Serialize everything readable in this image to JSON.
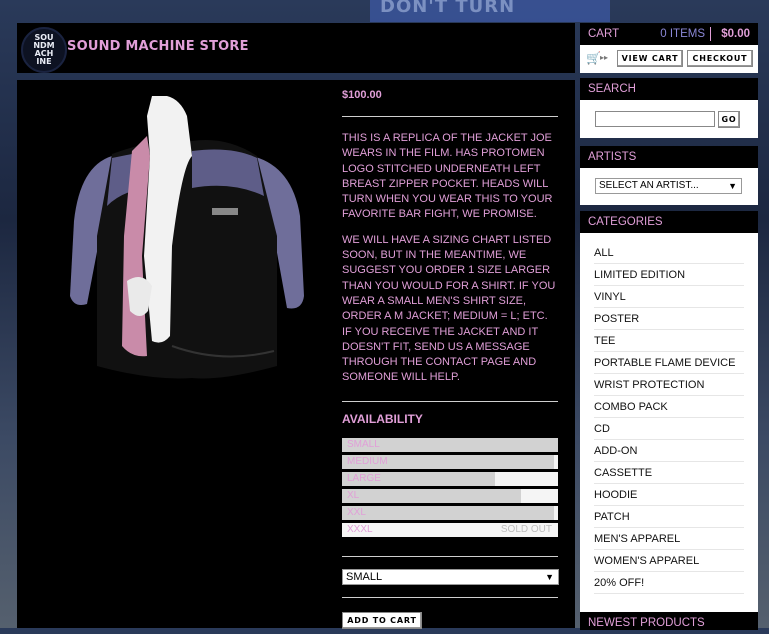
{
  "store": {
    "logo_text": "SOUND MACHINE",
    "name": "SOUND MACHINE STORE"
  },
  "product": {
    "price": "$100.00",
    "description": [
      "THIS IS A REPLICA OF THE JACKET JOE WEARS IN THE FILM. HAS PROTOMEN LOGO STITCHED UNDERNEATH LEFT BREAST ZIPPER POCKET. HEADS WILL TURN WHEN YOU WEAR THIS TO YOUR FAVORITE BAR FIGHT, WE PROMISE.",
      "WE WILL HAVE A SIZING CHART LISTED SOON, BUT IN THE MEANTIME, WE SUGGEST YOU ORDER 1 SIZE LARGER THAN YOU WOULD FOR A SHIRT. IF YOU WEAR A SMALL MEN'S SHIRT SIZE, ORDER A M JACKET; MEDIUM = L; ETC. IF YOU RECEIVE THE JACKET AND IT DOESN'T FIT, SEND US A MESSAGE THROUGH THE CONTACT PAGE AND SOMEONE WILL HELP."
    ],
    "availability_title": "AVAILABILITY",
    "availability": [
      {
        "size": "SMALL",
        "level": 1.0,
        "status": ""
      },
      {
        "size": "MEDIUM",
        "level": 0.98,
        "status": ""
      },
      {
        "size": "LARGE",
        "level": 0.71,
        "status": ""
      },
      {
        "size": "XL",
        "level": 0.83,
        "status": ""
      },
      {
        "size": "XXL",
        "level": 0.98,
        "status": ""
      },
      {
        "size": "XXXL",
        "level": 0.0,
        "status": "SOLD OUT"
      }
    ],
    "size_select": "SMALL",
    "add_to_cart": "ADD TO CART"
  },
  "cart": {
    "title": "CART",
    "items": "0 ITEMS",
    "total": "$0.00",
    "view_cart": "VIEW CART",
    "checkout": "CHECKOUT"
  },
  "search": {
    "title": "SEARCH",
    "placeholder": "",
    "go": "GO"
  },
  "artists": {
    "title": "ARTISTS",
    "select": "SELECT AN ARTIST..."
  },
  "categories": {
    "title": "CATEGORIES",
    "items": [
      "ALL",
      "LIMITED EDITION",
      "VINYL",
      "POSTER",
      "TEE",
      "PORTABLE FLAME DEVICE",
      "WRIST PROTECTION",
      "COMBO PACK",
      "CD",
      "ADD-ON",
      "CASSETTE",
      "HOODIE",
      "PATCH",
      "MEN'S APPAREL",
      "WOMEN'S APPAREL",
      "20% OFF!"
    ]
  },
  "newest": {
    "title": "NEWEST PRODUCTS"
  },
  "colors": {
    "accent": "#e19fd8",
    "panel": "#000000"
  }
}
